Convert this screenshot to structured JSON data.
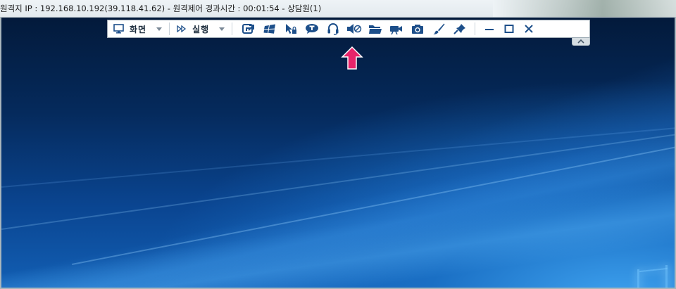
{
  "window": {
    "title": "원격지 IP : 192.168.10.192(39.118.41.62) - 원격제어 경과시간 : 00:01:54 - 상담원(1)"
  },
  "toolbar": {
    "screen_menu_label": "화면",
    "run_menu_label": "실행",
    "icons": [
      "remote-display-icon",
      "windows-key-icon",
      "cursor-lock-icon",
      "chat-icon",
      "headset-icon",
      "mute-volume-icon",
      "folder-icon",
      "video-camera-icon",
      "camera-icon",
      "brush-icon",
      "pin-icon"
    ],
    "window_controls": [
      "minimize-icon",
      "maximize-icon",
      "close-icon"
    ]
  },
  "colors": {
    "toolbar_icon": "#1d4f8a",
    "highlight_arrow": "#e8246a"
  }
}
